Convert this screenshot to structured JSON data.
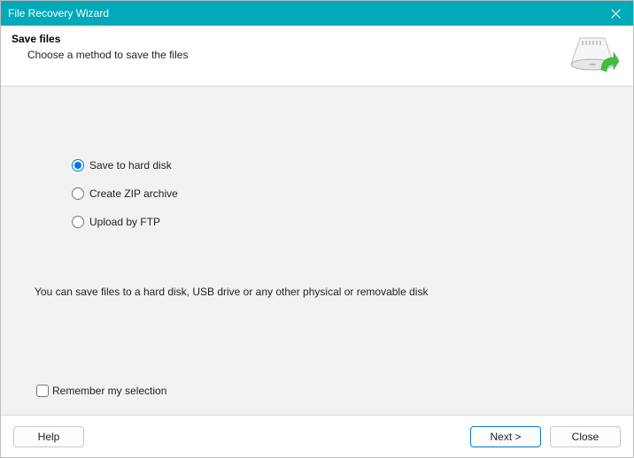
{
  "window": {
    "title": "File Recovery Wizard"
  },
  "header": {
    "title": "Save files",
    "subtitle": "Choose a method to save the files"
  },
  "options": [
    {
      "label": "Save to hard disk",
      "selected": true
    },
    {
      "label": "Create ZIP archive",
      "selected": false
    },
    {
      "label": "Upload by FTP",
      "selected": false
    }
  ],
  "hint": "You can save files to a hard disk, USB drive or any other physical or removable disk",
  "remember": {
    "label": "Remember my selection",
    "checked": false
  },
  "buttons": {
    "help": "Help",
    "next": "Next >",
    "close": "Close"
  }
}
